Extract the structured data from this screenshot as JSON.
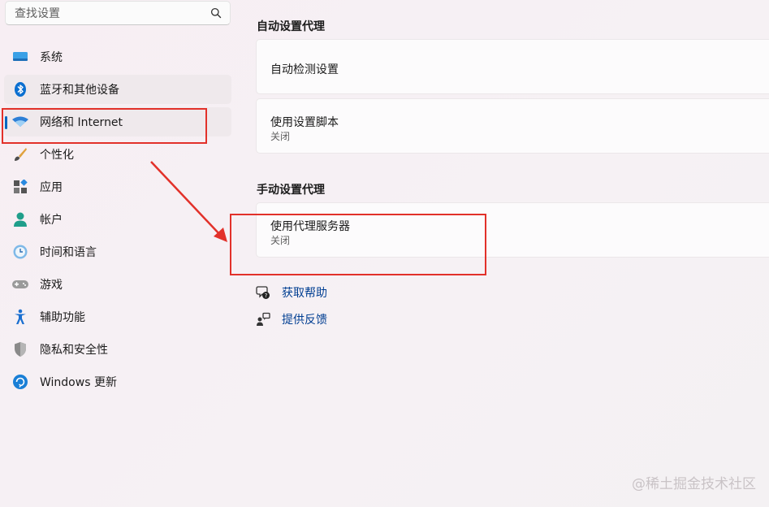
{
  "search": {
    "placeholder": "查找设置",
    "icon": "search-icon"
  },
  "sidebar": {
    "items": [
      {
        "label": "系统",
        "icon": "system-display-icon"
      },
      {
        "label": "蓝牙和其他设备",
        "icon": "bluetooth-icon"
      },
      {
        "label": "网络和 Internet",
        "icon": "wifi-icon",
        "selected": true
      },
      {
        "label": "个性化",
        "icon": "paintbrush-icon"
      },
      {
        "label": "应用",
        "icon": "apps-icon"
      },
      {
        "label": "帐户",
        "icon": "account-icon"
      },
      {
        "label": "时间和语言",
        "icon": "time-language-icon"
      },
      {
        "label": "游戏",
        "icon": "gamepad-icon"
      },
      {
        "label": "辅助功能",
        "icon": "accessibility-icon"
      },
      {
        "label": "隐私和安全性",
        "icon": "shield-icon"
      },
      {
        "label": "Windows 更新",
        "icon": "windows-update-icon"
      }
    ]
  },
  "main": {
    "auto_section": {
      "title": "自动设置代理",
      "detect": {
        "title": "自动检测设置"
      },
      "script": {
        "title": "使用设置脚本",
        "status": "关闭"
      }
    },
    "manual_section": {
      "title": "手动设置代理",
      "proxy": {
        "title": "使用代理服务器",
        "status": "关闭"
      }
    },
    "links": [
      {
        "label": "获取帮助",
        "icon": "help-icon"
      },
      {
        "label": "提供反馈",
        "icon": "feedback-icon"
      }
    ]
  },
  "annotation": {
    "color": "#e2312a"
  },
  "watermark": "@稀土掘金技术社区",
  "colors": {
    "accent": "#0067c0",
    "link": "#003e92"
  }
}
